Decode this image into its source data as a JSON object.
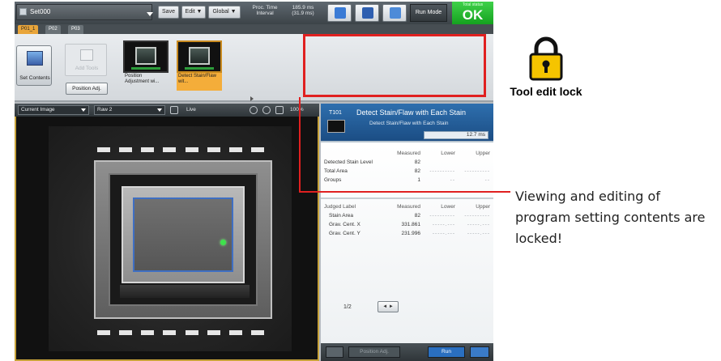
{
  "titlebar": {
    "file_name": "Set000",
    "save_label": "Save",
    "edit_label": "Edit ▼",
    "global_label": "Global ▼",
    "proc_time_label": "Proc. Time\nInterval",
    "proc_time_values": "185.9 ms\n(31.9 ms)",
    "run_mode_label": "Run Mode",
    "status_small": "Total status",
    "status_ok": "OK"
  },
  "program_tabs": [
    "P01_1",
    "P02",
    "P03"
  ],
  "tool_panel": {
    "set_contents_label": "Set Contents",
    "add_tools_label": "Add Tools",
    "position_adjustment_label": "Position Adj.",
    "tools": [
      {
        "name": "Position Adjustment wi..."
      },
      {
        "name": "Detect Stain/Flaw wit..."
      }
    ]
  },
  "image_toolbar": {
    "image_select": "Current Image",
    "raw_select": "Raw 2",
    "live_label": "Live",
    "zoom_label": "100%"
  },
  "result_panel": {
    "tool_id": "T101",
    "tool_title": "Detect Stain/Flaw with Each Stain",
    "tool_subtitle": "Detect Stain/Flaw with Each Stain",
    "time": "12.7 ms",
    "table1_headers": [
      "",
      "Measured",
      "Lower",
      "Upper"
    ],
    "table1_rows": [
      [
        "Detected Stain Level",
        "82",
        "",
        ""
      ],
      [
        "Total Area",
        "82",
        "----------",
        "----------"
      ],
      [
        "Groups",
        "1",
        "--",
        "--"
      ]
    ],
    "table2_headers": [
      "Judged Label",
      "Measured",
      "Lower",
      "Upper"
    ],
    "table2_rows": [
      [
        "Stain Area",
        "82",
        "----------",
        "----------"
      ],
      [
        "Grav. Cent. X",
        "331.861",
        "-----.---",
        "-----.---"
      ],
      [
        "Grav. Cent. Y",
        "231.996",
        "-----.---",
        "-----.---"
      ]
    ],
    "pager": "1/2",
    "pager_buttons": "◄ ►",
    "bottom_run_label": "Run",
    "bottom_mid_label": "Position Adj."
  },
  "annotation": {
    "lock_title": "Tool edit lock",
    "note": "Viewing and editing of program setting contents are locked!",
    "accent_color": "#e02020",
    "lock_color": "#f5c400",
    "lock_icon": "padlock-icon"
  }
}
